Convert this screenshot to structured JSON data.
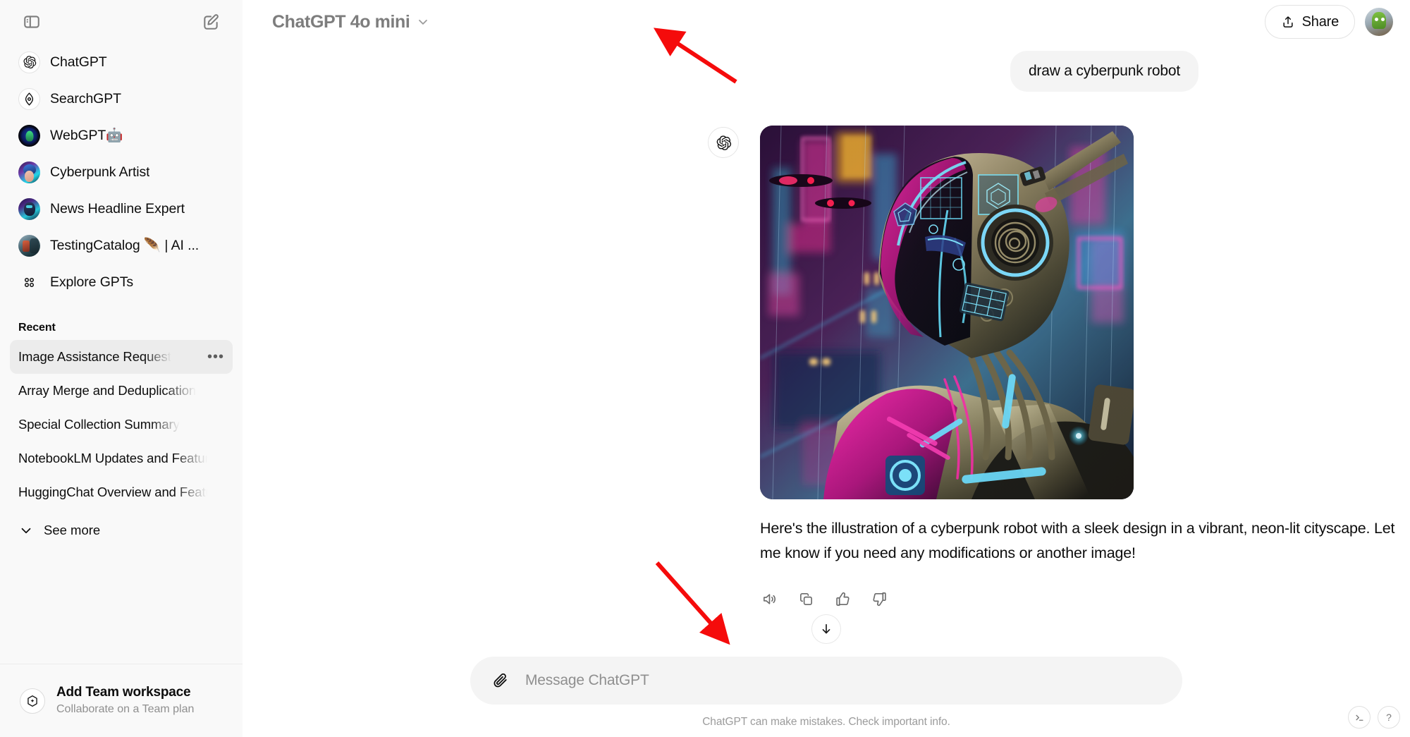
{
  "sidebar": {
    "toggle_icon": "sidebar-toggle-icon",
    "new_chat_icon": "compose-icon",
    "nav_items": [
      {
        "label": "ChatGPT",
        "icon": "openai-logo-icon"
      },
      {
        "label": "SearchGPT",
        "icon": "compass-icon"
      },
      {
        "label": "WebGPT🤖",
        "icon": "webgpt-avatar"
      },
      {
        "label": "Cyberpunk Artist",
        "icon": "cyberpunk-artist-avatar"
      },
      {
        "label": "News Headline Expert",
        "icon": "news-headline-expert-avatar"
      },
      {
        "label": "TestingCatalog 🪶 | AI ...",
        "icon": "testingcatalog-avatar"
      },
      {
        "label": "Explore GPTs",
        "icon": "grid-icon"
      }
    ],
    "recent_label": "Recent",
    "recent_chats": [
      {
        "title": "Image Assistance Request",
        "active": true
      },
      {
        "title": "Array Merge and Deduplication",
        "active": false
      },
      {
        "title": "Special Collection Summary",
        "active": false
      },
      {
        "title": "NotebookLM Updates and Features",
        "active": false
      },
      {
        "title": "HuggingChat Overview and Features",
        "active": false
      }
    ],
    "see_more_label": "See more",
    "team": {
      "title": "Add Team workspace",
      "subtitle": "Collaborate on a Team plan",
      "icon": "sparkle-hex-icon"
    }
  },
  "topbar": {
    "model_name": "ChatGPT 4o mini",
    "chevron_icon": "chevron-down-icon",
    "share_label": "Share",
    "share_icon": "share-upload-icon",
    "avatar_icon": "user-avatar"
  },
  "conversation": {
    "user_message": "draw a cyberpunk robot",
    "assistant_avatar": "openai-logo-icon",
    "assistant_image_alt": "cyberpunk robot in a neon-lit rainy cityscape",
    "assistant_text": "Here's the illustration of a cyberpunk robot with a sleek design in a vibrant, neon-lit cityscape. Let me know if you need any modifications or another image!",
    "actions": [
      {
        "name": "read-aloud-button",
        "icon": "speaker-icon"
      },
      {
        "name": "copy-button",
        "icon": "copy-icon"
      },
      {
        "name": "thumbs-up-button",
        "icon": "thumbs-up-icon"
      },
      {
        "name": "thumbs-down-button",
        "icon": "thumbs-down-icon"
      }
    ]
  },
  "composer": {
    "scroll_down_icon": "arrow-down-icon",
    "attach_icon": "paperclip-icon",
    "placeholder": "Message ChatGPT",
    "value": "",
    "disclaimer": "ChatGPT can make mistakes. Check important info."
  },
  "corner_tools": [
    {
      "name": "console-button",
      "glyph": ">_"
    },
    {
      "name": "help-button",
      "glyph": "?"
    }
  ],
  "annotations": {
    "arrow_color": "#f50b0b",
    "arrow_1_target": "model-selector",
    "arrow_2_target": "message-composer"
  },
  "colors": {
    "sidebar_bg": "#f9f9f9",
    "main_bg": "#ffffff",
    "bubble_bg": "#f4f4f4",
    "text_primary": "#0d0d0d",
    "text_muted": "#8f8f8f",
    "accent_red": "#f50b0b"
  }
}
